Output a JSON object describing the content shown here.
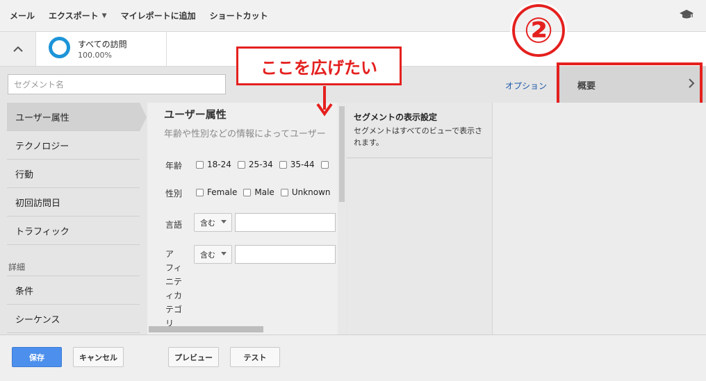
{
  "toolbar": {
    "mail": "メール",
    "export": "エクスポート",
    "add_report": "マイレポートに追加",
    "shortcut": "ショートカット"
  },
  "segment": {
    "name": "すべての訪問",
    "percent": "100.00%"
  },
  "annotations": {
    "circled_number": "②",
    "callout": "ここを広げたい"
  },
  "editor": {
    "segment_name_placeholder": "セグメント名",
    "option_link": "オプション",
    "summary_tab": "概要"
  },
  "left_nav": {
    "items": [
      "ユーザー属性",
      "テクノロジー",
      "行動",
      "初回訪問日",
      "トラフィック"
    ],
    "section_label": "詳細",
    "detail_items": [
      "条件",
      "シーケンス"
    ]
  },
  "form": {
    "title": "ユーザー属性",
    "description": "年齢や性別などの情報によってユーザー",
    "age_label": "年齢",
    "age_options": [
      "18-24",
      "25-34",
      "35-44"
    ],
    "gender_label": "性別",
    "gender_options": [
      "Female",
      "Male",
      "Unknown"
    ],
    "language_label": "言語",
    "contains": "含む",
    "affinity_label": "アフィニティカテゴリ"
  },
  "settings": {
    "title": "セグメントの表示設定",
    "description": "セグメントはすべてのビューで表示されます。"
  },
  "buttons": {
    "save": "保存",
    "cancel": "キャンセル",
    "preview": "プレビュー",
    "test": "テスト"
  },
  "colors": {
    "accent_red": "#e4201e",
    "primary_blue": "#4d8fec",
    "ring_blue": "#1d94d8"
  }
}
